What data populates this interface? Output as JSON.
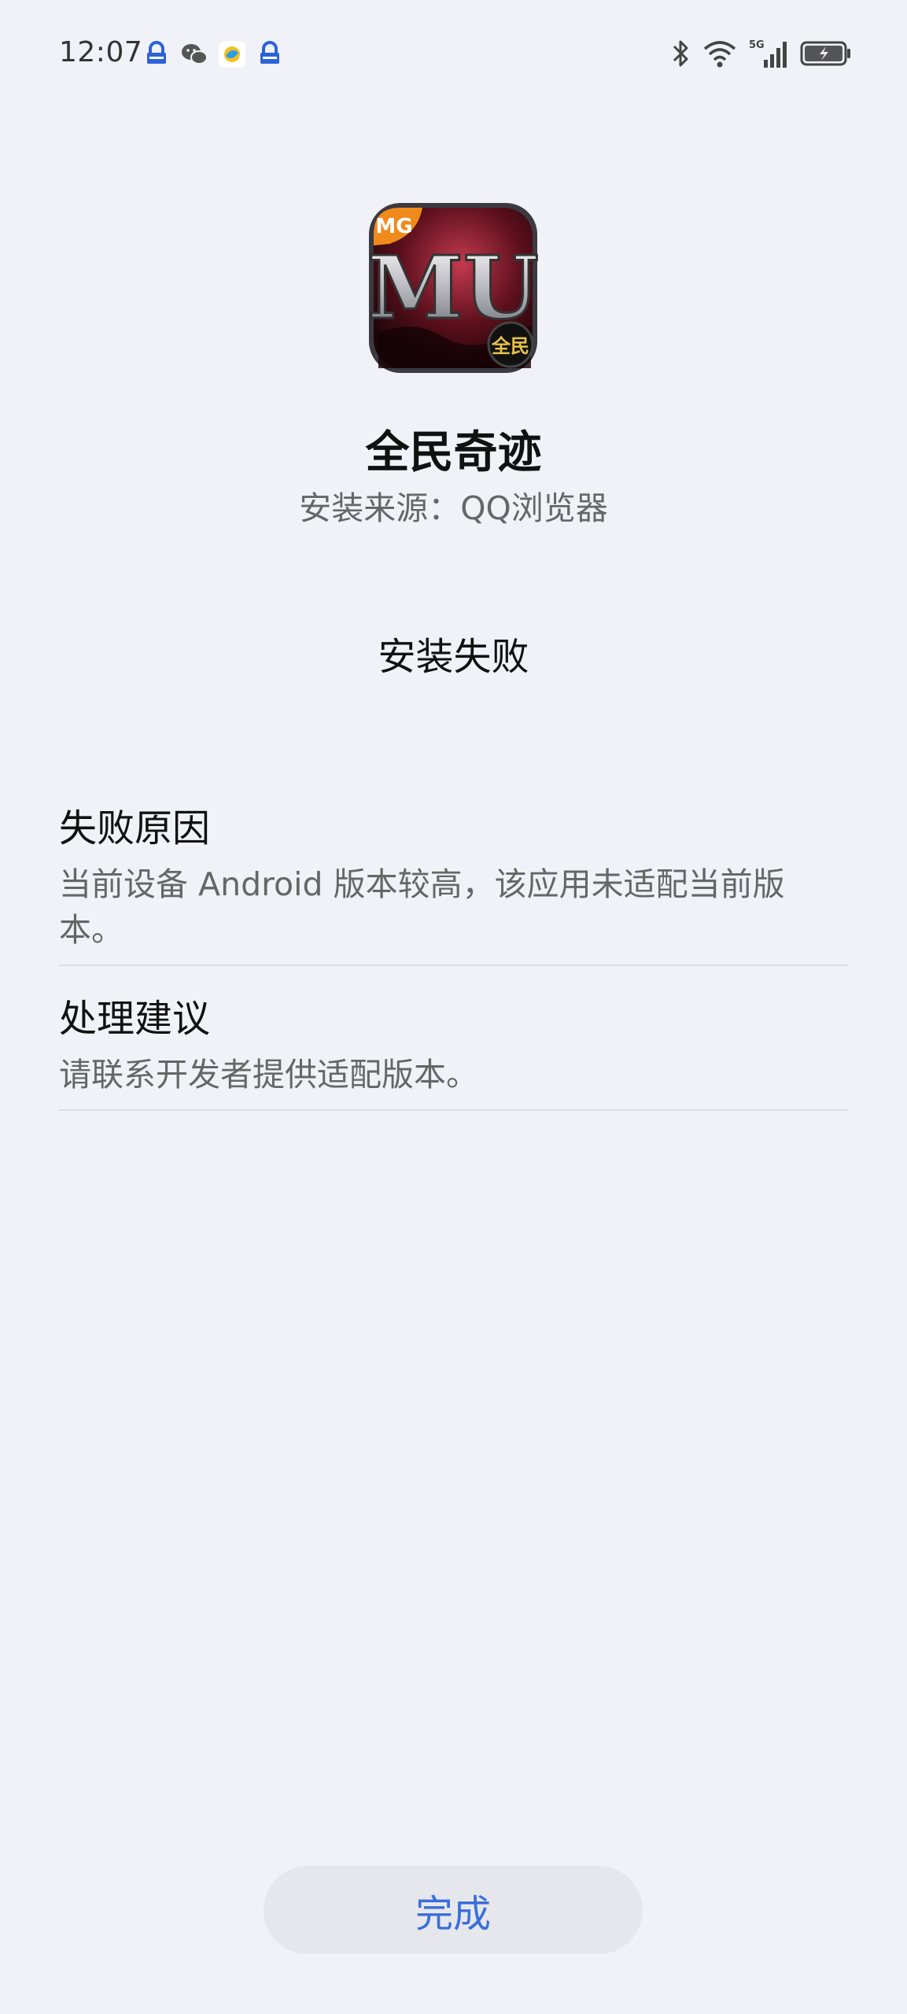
{
  "status_bar": {
    "time": "12:07",
    "notification_icons": [
      "vpn-lock-icon",
      "wechat-icon",
      "browser-icon",
      "vpn-lock-icon"
    ],
    "right_icons": [
      "bluetooth-icon",
      "wifi-icon",
      "signal-5g-icon",
      "battery-charging-icon"
    ],
    "network_type": "5G"
  },
  "app": {
    "icon_badge": "MG",
    "icon_text": "MU",
    "icon_corner": "全民",
    "name": "全民奇迹",
    "source": "安装来源：QQ浏览器"
  },
  "install": {
    "status": "安装失败"
  },
  "failure_reason": {
    "title": "失败原因",
    "text_line1": "当前设备 Android 版本较高，该应用未适配当前版",
    "text_line2": "本。"
  },
  "suggestion": {
    "title": "处理建议",
    "text": "请联系开发者提供适配版本。"
  },
  "actions": {
    "done_label": "完成"
  },
  "colors": {
    "background": "#f1f2f7",
    "accent": "#3a6fd9",
    "button_bg": "#e6e7ec"
  }
}
